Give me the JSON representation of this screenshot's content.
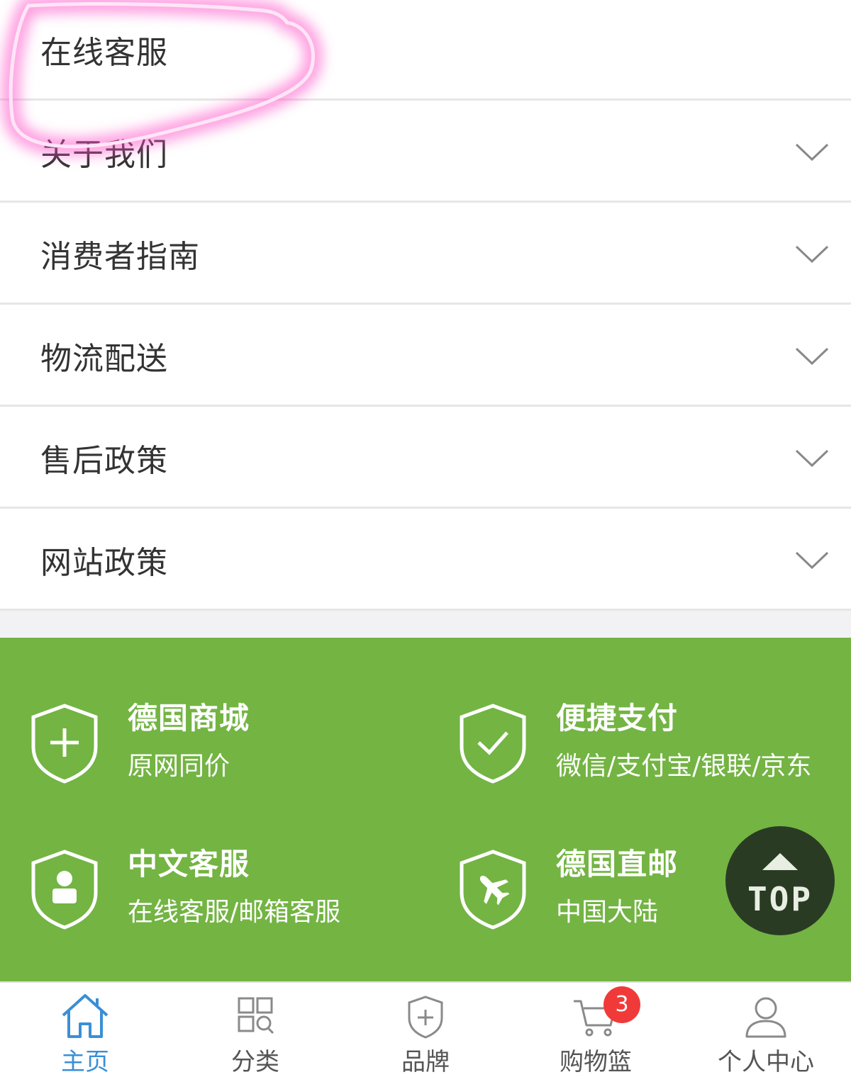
{
  "menu": {
    "items": [
      {
        "label": "在线客服",
        "expandable": false
      },
      {
        "label": "关于我们",
        "expandable": true
      },
      {
        "label": "消费者指南",
        "expandable": true
      },
      {
        "label": "物流配送",
        "expandable": true
      },
      {
        "label": "售后政策",
        "expandable": true
      },
      {
        "label": "网站政策",
        "expandable": true
      }
    ]
  },
  "features": [
    {
      "title": "德国商城",
      "subtitle": "原网同价",
      "icon": "shield-plus-icon"
    },
    {
      "title": "便捷支付",
      "subtitle": "微信/支付宝/银联/京东",
      "icon": "shield-check-icon"
    },
    {
      "title": "中文客服",
      "subtitle": "在线客服/邮箱客服",
      "icon": "shield-person-icon"
    },
    {
      "title": "德国直邮",
      "subtitle": "中国大陆",
      "icon": "shield-plane-icon"
    }
  ],
  "back_to_top": {
    "label": "TOP"
  },
  "tabbar": {
    "tabs": [
      {
        "label": "主页",
        "icon": "home-icon",
        "active": true
      },
      {
        "label": "分类",
        "icon": "grid-search-icon",
        "active": false
      },
      {
        "label": "品牌",
        "icon": "shield-plus-icon",
        "active": false
      },
      {
        "label": "购物篮",
        "icon": "cart-icon",
        "active": false
      },
      {
        "label": "个人中心",
        "icon": "user-icon",
        "active": false
      }
    ],
    "cart_badge": "3"
  },
  "colors": {
    "footer_green": "#73b443",
    "active_tab": "#3a8fd6",
    "badge_red": "#f03a3a",
    "top_button": "#2a3b23",
    "highlight_pink": "#ff4fc8"
  }
}
